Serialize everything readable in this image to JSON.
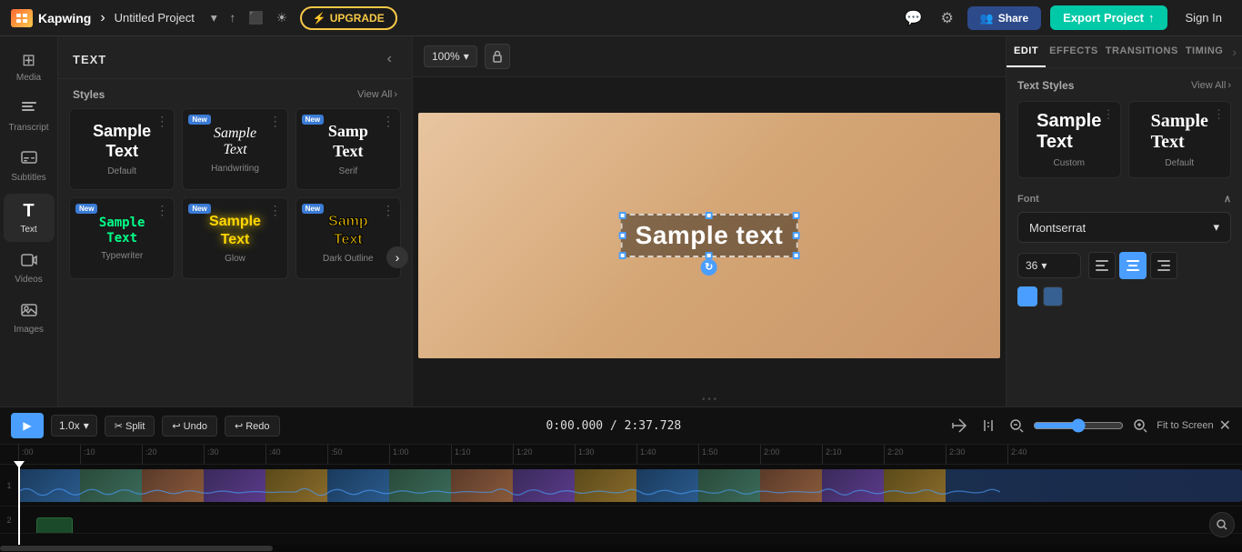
{
  "app": {
    "logo": "K",
    "brand": "Kapwing",
    "project_name": "Untitled Project",
    "breadcrumb_sep": "›"
  },
  "topbar": {
    "upgrade_label": "UPGRADE",
    "upgrade_icon": "⚡",
    "share_label": "Share",
    "share_icon": "👥",
    "export_label": "Export Project",
    "export_icon": "↑",
    "signin_label": "Sign In"
  },
  "left_sidebar": {
    "items": [
      {
        "id": "media",
        "icon": "⊞",
        "label": "Media"
      },
      {
        "id": "transcript",
        "icon": "≡",
        "label": "Transcript"
      },
      {
        "id": "subtitles",
        "icon": "□",
        "label": "Subtitles"
      },
      {
        "id": "text",
        "icon": "T",
        "label": "Text",
        "active": true
      },
      {
        "id": "videos",
        "icon": "▶",
        "label": "Videos"
      },
      {
        "id": "images",
        "icon": "🖼",
        "label": "Images"
      }
    ]
  },
  "text_panel": {
    "title": "TEXT",
    "styles_label": "Styles",
    "view_all": "View All",
    "cards": [
      {
        "id": "default",
        "label": "Default",
        "text": "Sample\nText",
        "style": "default",
        "new": false
      },
      {
        "id": "handwriting",
        "label": "Handwriting",
        "text": "Sample\nText",
        "style": "handwriting",
        "new": true
      },
      {
        "id": "serif",
        "label": "Serif",
        "text": "Samp\nText",
        "style": "serif",
        "new": true
      },
      {
        "id": "typewriter",
        "label": "Typewriter",
        "text": "Sample\nText",
        "style": "typewriter",
        "new": true
      },
      {
        "id": "glow",
        "label": "Glow",
        "text": "Sample\nText",
        "style": "glow",
        "new": true
      },
      {
        "id": "dark-outline",
        "label": "Dark Outline",
        "text": "Samp\nText",
        "style": "dark-outline",
        "new": true
      }
    ]
  },
  "canvas": {
    "zoom": "100%",
    "text_element": "Sample text"
  },
  "right_panel": {
    "tabs": [
      "EDIT",
      "EFFECTS",
      "TRANSITIONS",
      "TIMING"
    ],
    "active_tab": "EDIT",
    "text_styles_label": "Text Styles",
    "view_all": "View All",
    "styles": [
      {
        "id": "custom",
        "label": "Custom",
        "text": "Sample\nText"
      },
      {
        "id": "default-ts",
        "label": "Default",
        "text": "Sample\nText"
      }
    ],
    "font_label": "Font",
    "font_value": "Montserrat",
    "font_size": "36",
    "align_options": [
      "left",
      "center",
      "right"
    ],
    "active_align": "center"
  },
  "timeline": {
    "play_icon": "▶",
    "speed": "1.0x",
    "split_label": "✂ Split",
    "undo_label": "↩ Undo",
    "redo_label": "↩ Redo",
    "current_time": "0:00.000",
    "total_time": "2:37.728",
    "fit_screen_label": "Fit to Screen",
    "ruler_marks": [
      ":00",
      ":10",
      ":20",
      ":30",
      ":40",
      ":50",
      "1:00",
      "1:10",
      "1:20",
      "1:30",
      "1:40",
      "1:50",
      "2:00",
      "2:10",
      "2:20",
      "2:30",
      "2:40"
    ],
    "track_1_label": "1",
    "track_2_label": "2"
  }
}
